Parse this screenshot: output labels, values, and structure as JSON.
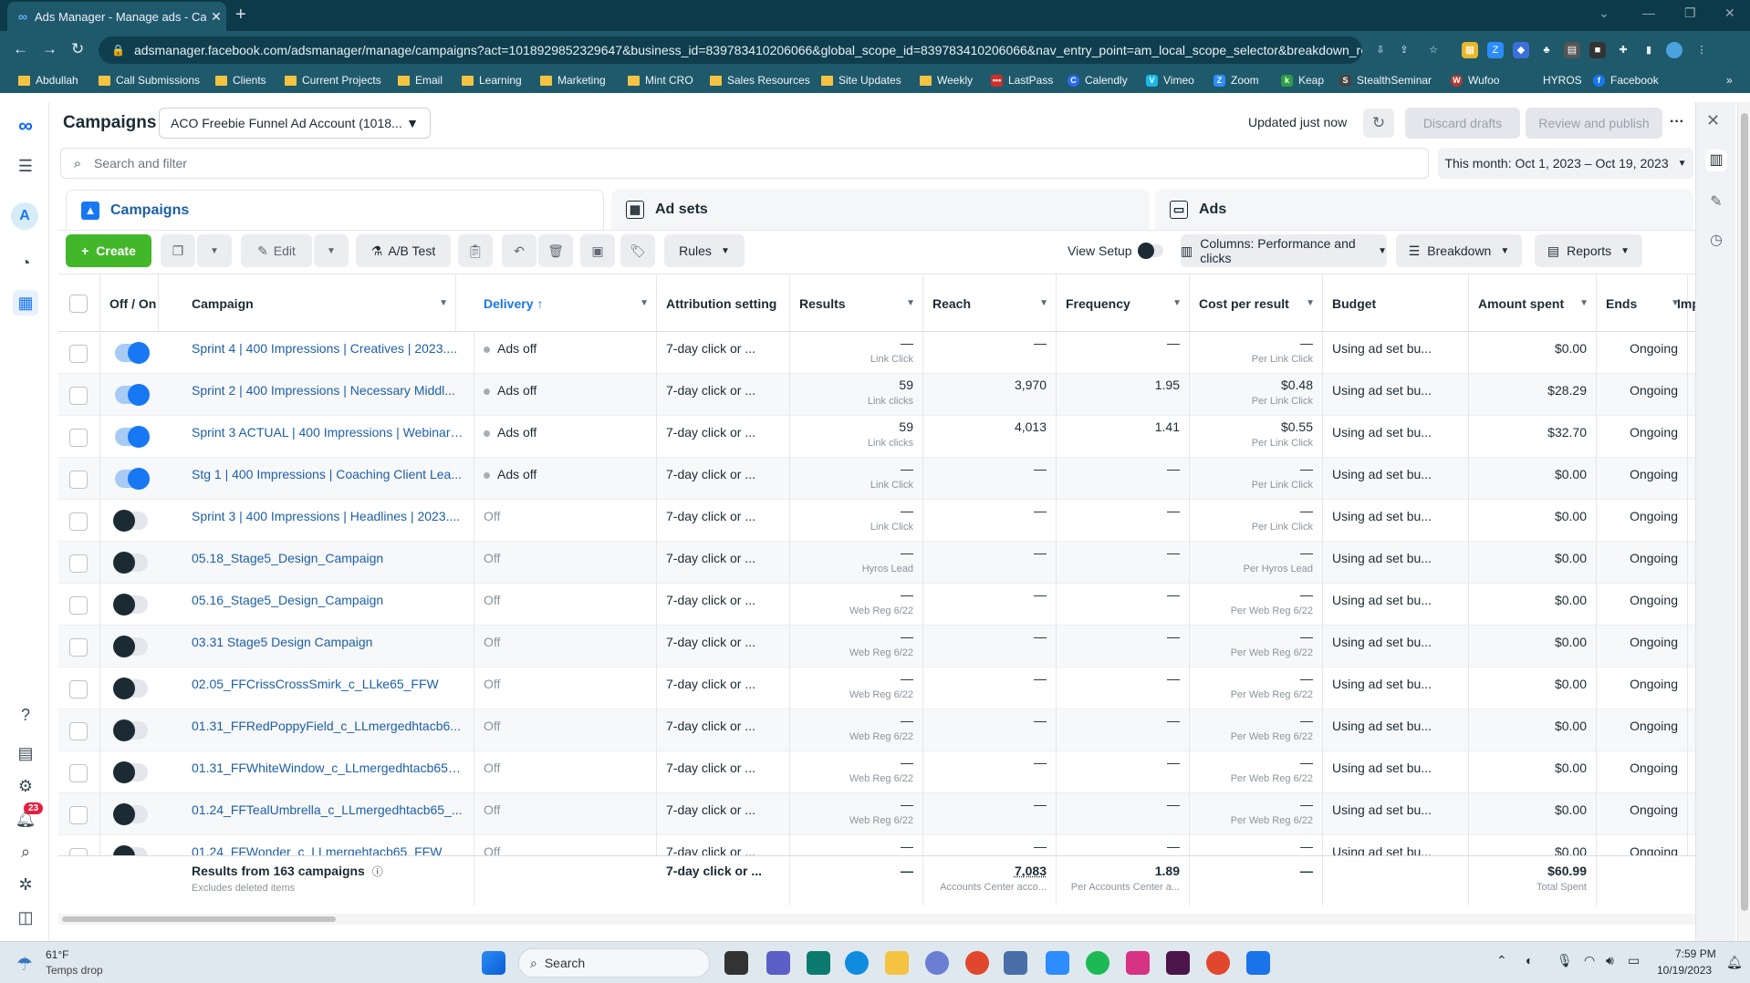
{
  "browser": {
    "tab_title": "Ads Manager - Manage ads - Ca",
    "url": "adsmanager.facebook.com/adsmanager/manage/campaigns?act=1018929852329647&business_id=839783410206066&global_scope_id=839783410206066&nav_entry_point=am_local_scope_selector&breakdown_re..."
  },
  "bookmarks": [
    "Abdullah",
    "Call Submissions",
    "Clients",
    "Current Projects",
    "Email",
    "Learning",
    "Marketing",
    "Mint CRO",
    "Sales Resources",
    "Site Updates",
    "Weekly",
    "LastPass",
    "Calendly",
    "Vimeo",
    "Zoom",
    "Keap",
    "StealthSeminar",
    "Wufoo",
    "HYROS",
    "Facebook"
  ],
  "header": {
    "title": "Campaigns",
    "account": "ACO Freebie Funnel Ad Account (1018...",
    "updated": "Updated just now",
    "discard": "Discard drafts",
    "review": "Review and publish"
  },
  "search": {
    "placeholder": "Search and filter",
    "date_range": "This month: Oct 1, 2023 – Oct 19, 2023"
  },
  "level_tabs": [
    "Campaigns",
    "Ad sets",
    "Ads"
  ],
  "toolbar": {
    "create": "Create",
    "edit": "Edit",
    "ab_test": "A/B Test",
    "rules": "Rules",
    "view_setup": "View Setup",
    "columns": "Columns: Performance and clicks",
    "breakdown": "Breakdown",
    "reports": "Reports"
  },
  "columns": {
    "off_on": "Off / On",
    "campaign": "Campaign",
    "delivery": "Delivery",
    "attribution": "Attribution setting",
    "results": "Results",
    "reach": "Reach",
    "frequency": "Frequency",
    "cost": "Cost per result",
    "budget": "Budget",
    "spent": "Amount spent",
    "ends": "Ends",
    "impr": "Impre"
  },
  "rows": [
    {
      "on": true,
      "campaign": "Sprint 4 | 400 Impressions | Creatives | 2023....",
      "delivery": "Ads off",
      "attr": "7-day click or ...",
      "results": "—",
      "results_sub": "Link Click",
      "reach": "—",
      "freq": "—",
      "cost": "—",
      "cost_sub": "Per Link Click",
      "budget": "Using ad set bu...",
      "spent": "$0.00",
      "ends": "Ongoing"
    },
    {
      "on": true,
      "campaign": "Sprint 2 | 400 Impressions | Necessary Middl...",
      "delivery": "Ads off",
      "attr": "7-day click or ...",
      "results": "59",
      "results_sub": "Link clicks",
      "reach": "3,970",
      "freq": "1.95",
      "cost": "$0.48",
      "cost_sub": "Per Link Click",
      "budget": "Using ad set bu...",
      "spent": "$28.29",
      "ends": "Ongoing"
    },
    {
      "on": true,
      "campaign": "Sprint 3 ACTUAL | 400 Impressions | Webinar ...",
      "delivery": "Ads off",
      "attr": "7-day click or ...",
      "results": "59",
      "results_sub": "Link clicks",
      "reach": "4,013",
      "freq": "1.41",
      "cost": "$0.55",
      "cost_sub": "Per Link Click",
      "budget": "Using ad set bu...",
      "spent": "$32.70",
      "ends": "Ongoing"
    },
    {
      "on": true,
      "campaign": "Stg 1 | 400 Impressions | Coaching Client Lea...",
      "delivery": "Ads off",
      "attr": "7-day click or ...",
      "results": "—",
      "results_sub": "Link Click",
      "reach": "—",
      "freq": "—",
      "cost": "—",
      "cost_sub": "Per Link Click",
      "budget": "Using ad set bu...",
      "spent": "$0.00",
      "ends": "Ongoing"
    },
    {
      "on": false,
      "campaign": "Sprint 3 | 400 Impressions | Headlines | 2023....",
      "delivery": "Off",
      "attr": "7-day click or ...",
      "results": "—",
      "results_sub": "Link Click",
      "reach": "—",
      "freq": "—",
      "cost": "—",
      "cost_sub": "Per Link Click",
      "budget": "Using ad set bu...",
      "spent": "$0.00",
      "ends": "Ongoing"
    },
    {
      "on": false,
      "campaign": "05.18_Stage5_Design_Campaign",
      "delivery": "Off",
      "attr": "7-day click or ...",
      "results": "—",
      "results_sub": "Hyros Lead",
      "reach": "—",
      "freq": "—",
      "cost": "—",
      "cost_sub": "Per Hyros Lead",
      "budget": "Using ad set bu...",
      "spent": "$0.00",
      "ends": "Ongoing"
    },
    {
      "on": false,
      "campaign": "05.16_Stage5_Design_Campaign",
      "delivery": "Off",
      "attr": "7-day click or ...",
      "results": "—",
      "results_sub": "Web Reg 6/22",
      "reach": "—",
      "freq": "—",
      "cost": "—",
      "cost_sub": "Per Web Reg 6/22",
      "budget": "Using ad set bu...",
      "spent": "$0.00",
      "ends": "Ongoing"
    },
    {
      "on": false,
      "campaign": "03.31 Stage5 Design Campaign",
      "delivery": "Off",
      "attr": "7-day click or ...",
      "results": "—",
      "results_sub": "Web Reg 6/22",
      "reach": "—",
      "freq": "—",
      "cost": "—",
      "cost_sub": "Per Web Reg 6/22",
      "budget": "Using ad set bu...",
      "spent": "$0.00",
      "ends": "Ongoing"
    },
    {
      "on": false,
      "campaign": "02.05_FFCrissCrossSmirk_c_LLke65_FFW",
      "delivery": "Off",
      "attr": "7-day click or ...",
      "results": "—",
      "results_sub": "Web Reg 6/22",
      "reach": "—",
      "freq": "—",
      "cost": "—",
      "cost_sub": "Per Web Reg 6/22",
      "budget": "Using ad set bu...",
      "spent": "$0.00",
      "ends": "Ongoing"
    },
    {
      "on": false,
      "campaign": "01.31_FFRedPoppyField_c_LLmergedhtacb6...",
      "delivery": "Off",
      "attr": "7-day click or ...",
      "results": "—",
      "results_sub": "Web Reg 6/22",
      "reach": "—",
      "freq": "—",
      "cost": "—",
      "cost_sub": "Per Web Reg 6/22",
      "budget": "Using ad set bu...",
      "spent": "$0.00",
      "ends": "Ongoing"
    },
    {
      "on": false,
      "campaign": "01.31_FFWhiteWindow_c_LLmergedhtacb65_...",
      "delivery": "Off",
      "attr": "7-day click or ...",
      "results": "—",
      "results_sub": "Web Reg 6/22",
      "reach": "—",
      "freq": "—",
      "cost": "—",
      "cost_sub": "Per Web Reg 6/22",
      "budget": "Using ad set bu...",
      "spent": "$0.00",
      "ends": "Ongoing"
    },
    {
      "on": false,
      "campaign": "01.24_FFTealUmbrella_c_LLmergedhtacb65_...",
      "delivery": "Off",
      "attr": "7-day click or ...",
      "results": "—",
      "results_sub": "Web Reg 6/22",
      "reach": "—",
      "freq": "—",
      "cost": "—",
      "cost_sub": "Per Web Reg 6/22",
      "budget": "Using ad set bu...",
      "spent": "$0.00",
      "ends": "Ongoing"
    },
    {
      "on": false,
      "campaign": "01.24_FFWonder_c_LLmergehtacb65_FFW",
      "delivery": "Off",
      "attr": "7-day click or ...",
      "results": "—",
      "results_sub": "",
      "reach": "—",
      "freq": "—",
      "cost": "—",
      "cost_sub": "",
      "budget": "Using ad set bu...",
      "spent": "$0.00",
      "ends": "Ongoing"
    }
  ],
  "footer": {
    "title": "Results from 163 campaigns",
    "sub": "Excludes deleted items",
    "attr": "7-day click or ...",
    "results": "—",
    "reach": "7,083",
    "reach_sub": "Accounts Center acco...",
    "freq": "1.89",
    "freq_sub": "Per Accounts Center a...",
    "cost": "—",
    "spent": "$60.99",
    "spent_sub": "Total Spent"
  },
  "sidebar_badge": "23",
  "taskbar": {
    "weather_temp": "61°F",
    "weather_desc": "Temps drop",
    "search": "Search",
    "time": "7:59 PM",
    "date": "10/19/2023"
  },
  "colors": {
    "accent": "#1877f2",
    "create": "#42b72a",
    "link": "#1c5fa8"
  }
}
